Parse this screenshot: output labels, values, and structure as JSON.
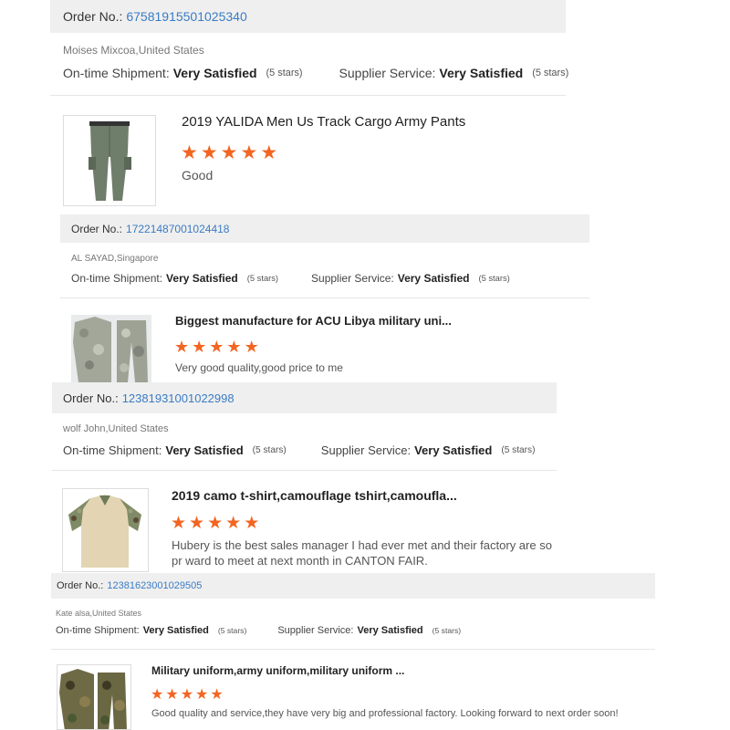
{
  "reviews": [
    {
      "order_label": "Order No.:",
      "order_number": "67581915501025340",
      "buyer": "Moises Mixcoa,United States",
      "shipment_label": "On-time Shipment:",
      "shipment_value": "Very Satisfied",
      "shipment_stars": "(5 stars)",
      "service_label": "Supplier Service:",
      "service_value": "Very Satisfied",
      "service_stars": "(5 stars)"
    },
    {
      "title": "2019 YALIDA Men Us Track Cargo Army Pants",
      "rating": 5,
      "comment": "Good",
      "order_label": "Order No.:",
      "order_number": "17221487001024418",
      "buyer": "AL SAYAD,Singapore",
      "shipment_label": "On-time Shipment:",
      "shipment_value": "Very Satisfied",
      "shipment_stars": "(5 stars)",
      "service_label": "Supplier Service:",
      "service_value": "Very Satisfied",
      "service_stars": "(5 stars)"
    },
    {
      "title": "Biggest manufacture for ACU Libya military uni...",
      "rating": 5,
      "comment": "Very good quality,good price to me",
      "order_label": "Order No.:",
      "order_number": "12381931001022998",
      "buyer": "wolf John,United States",
      "shipment_label": "On-time Shipment:",
      "shipment_value": "Very Satisfied",
      "shipment_stars": "(5 stars)",
      "service_label": "Supplier Service:",
      "service_value": "Very Satisfied",
      "service_stars": "(5 stars)"
    },
    {
      "title": "2019 camo t-shirt,camouflage tshirt,camoufla...",
      "rating": 5,
      "comment": "Hubery is the best sales manager I had ever met and their factory are so pr ward to meet at next month in CANTON FAIR.",
      "order_label": "Order No.:",
      "order_number": "12381623001029505",
      "buyer": "Kate alsa,United States",
      "shipment_label": "On-time Shipment:",
      "shipment_value": "Very Satisfied",
      "shipment_stars": "(5 stars)",
      "service_label": "Supplier Service:",
      "service_value": "Very Satisfied",
      "service_stars": "(5 stars)"
    },
    {
      "title": "Military uniform,army uniform,military uniform ...",
      "rating": 5,
      "comment": "Good quality and service,they have very big and professional factory. Looking forward to next order soon!"
    }
  ],
  "colors": {
    "star": "#f26522",
    "order_link": "#3a7cc4",
    "order_bar": "#efefef"
  },
  "icons": {
    "star": "filled-star-icon",
    "pants": "army-cargo-pants-image",
    "acu_suit": "acu-camo-uniform-image",
    "camo_shirt": "camo-combat-shirt-image",
    "woodland_uniform": "woodland-camo-uniform-image"
  }
}
